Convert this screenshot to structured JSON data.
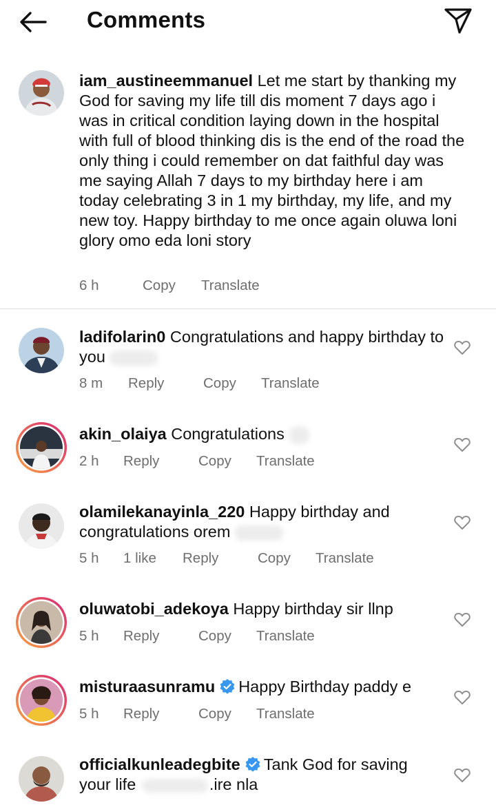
{
  "header": {
    "title": "Comments",
    "back_icon": "arrow-left-icon",
    "send_icon": "paper-plane-icon"
  },
  "caption": {
    "username": "iam_austineemmanuel",
    "text": "Let me start by thanking my God for saving my life till dis moment 7 days ago i was in critical condition laying down in the hospital with full of blood thinking dis is the end of the road the only thing i could remember on dat faithful day was me saying Allah 7 days to my birthday here i am today celebrating 3 in 1 my birthday, my life,  and my new toy. Happy birthday to me once again oluwa loni glory omo eda loni story",
    "time": "6 h",
    "copy": "Copy",
    "translate": "Translate"
  },
  "comments": [
    {
      "username": "ladifolarin0",
      "text": "Congratulations and happy birthday to you",
      "time": "8 m",
      "reply": "Reply",
      "copy": "Copy",
      "translate": "Translate"
    },
    {
      "username": "akin_olaiya",
      "text": "Congratulations",
      "time": "2 h",
      "reply": "Reply",
      "copy": "Copy",
      "translate": "Translate"
    },
    {
      "username": "olamilekanayinla_220",
      "text": "Happy birthday and congratulations orem",
      "time": "5 h",
      "likes": "1 like",
      "reply": "Reply",
      "copy": "Copy",
      "translate": "Translate"
    },
    {
      "username": "oluwatobi_adekoya",
      "text": "Happy birthday sir llnp",
      "time": "5 h",
      "reply": "Reply",
      "copy": "Copy",
      "translate": "Translate"
    },
    {
      "username": "misturaasunramu",
      "text": "Happy Birthday paddy e",
      "time": "5 h",
      "reply": "Reply",
      "copy": "Copy",
      "translate": "Translate",
      "verified": true
    },
    {
      "username": "officialkunleadegbite",
      "text_a": "Tank God for saving",
      "text_b": "your life",
      "text_c": ".ire nla",
      "verified": true
    }
  ],
  "colors": {
    "text": "#111111",
    "meta": "#6e6e6e",
    "verified": "#3897f0",
    "ring_start": "#f9a03f",
    "ring_end": "#d62976"
  }
}
